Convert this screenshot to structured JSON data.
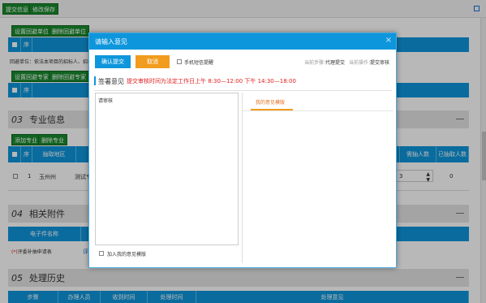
{
  "toolbar": {
    "submit_label": "提交信息",
    "save_label": "修改保存"
  },
  "returns": {
    "set_unit_label": "设置回避单位",
    "del_unit_label": "删除回避单位",
    "seq_header": "序",
    "note": "回避单位：依法本项目的招标人、招标代理...",
    "set_expert_label": "设置回避专家",
    "del_expert_label": "删除回避专家",
    "seq_header2": "序"
  },
  "section03": {
    "num": "03",
    "title": "专业信息",
    "add_label": "添加专业",
    "del_label": "删除专业",
    "headers": {
      "seq": "序",
      "region": "抽取地区",
      "need": "需抽人数",
      "drawn": "已抽取人数"
    },
    "row": {
      "seq": "1",
      "region": "玉州州",
      "type": "测试专",
      "need": "3",
      "drawn": "0"
    }
  },
  "section04": {
    "num": "04",
    "title": "相关附件",
    "headers": {
      "filename": "电子件名称"
    },
    "file": "评委补抽申请表",
    "file_prefix": "(*)",
    "file_link": "评"
  },
  "section05": {
    "num": "05",
    "title": "处理历史",
    "headers": {
      "step": "步骤",
      "handler": "办理人员",
      "recv_time": "收到时间",
      "proc_time": "处理时间",
      "opinion": "处理意见"
    }
  },
  "modal": {
    "title": "请输入意见",
    "confirm_label": "确认提交",
    "cancel_label": "取消",
    "sms_label": "手机短信提醒",
    "step_label": "当前步骤：",
    "step_value": "代理提交",
    "op_label": "当前操作：",
    "op_value": "提交审核",
    "sign_label": "签署意见",
    "notice": "提交审核时间为法定工作日上午 8:30—12:00 下午 14:30—18:00",
    "textarea_value": "请审核",
    "tab_label": "我的意见模版",
    "add_template_label": "加入我的意见模版"
  },
  "colors": {
    "accent": "#0e96dc",
    "green": "#1a8a2e",
    "orange": "#f29c1f",
    "notice": "#e02020"
  },
  "icons": [
    "close-icon",
    "menu-icon",
    "collapse-icon",
    "spinner-icon"
  ]
}
